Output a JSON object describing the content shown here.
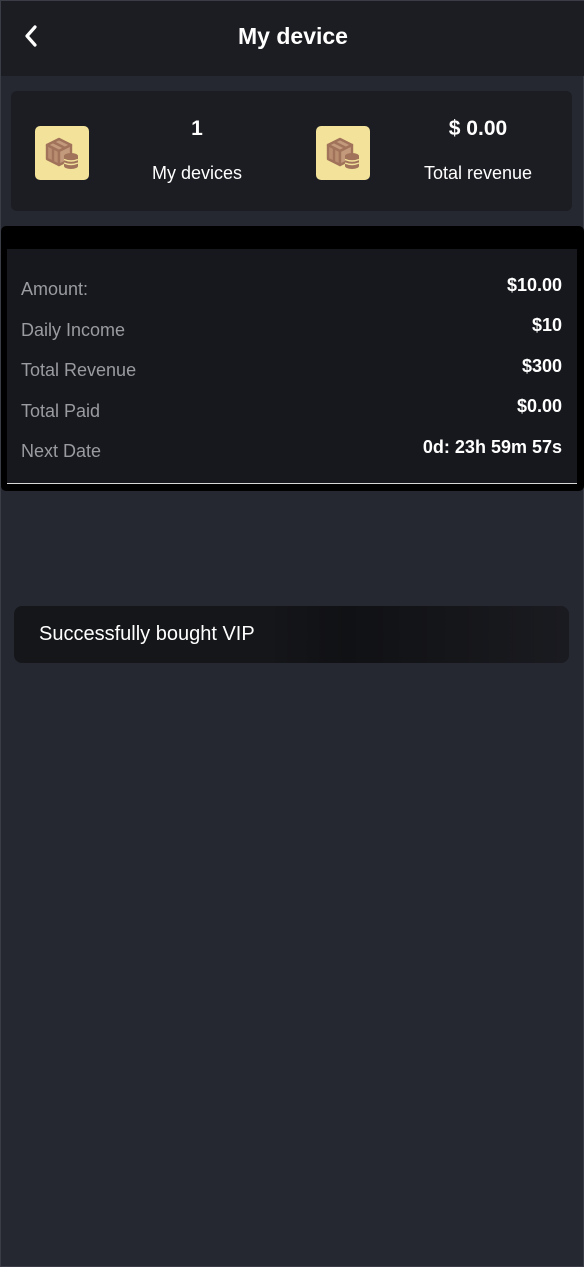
{
  "header": {
    "title": "My device",
    "back_icon": "chevron-left-icon"
  },
  "stats": {
    "devices": {
      "value": "1",
      "label": "My devices",
      "icon": "device-coins-icon"
    },
    "revenue": {
      "value": "$ 0.00",
      "label": "Total revenue",
      "icon": "device-coins-icon"
    }
  },
  "details": {
    "rows": [
      {
        "label": "Amount:",
        "value": "$10.00"
      },
      {
        "label": "Daily Income",
        "value": "$10"
      },
      {
        "label": "Total Revenue",
        "value": "$300"
      },
      {
        "label": "Total Paid",
        "value": "$0.00"
      },
      {
        "label": "Next Date",
        "value": "0d: 23h 59m 57s"
      }
    ]
  },
  "toast": {
    "message": "Successfully bought VIP"
  },
  "colors": {
    "background": "#252831",
    "card": "#1c1d22",
    "icon_bg": "#f3e29a",
    "icon_fg": "#a0735a",
    "muted_text": "#9a9ba1"
  }
}
